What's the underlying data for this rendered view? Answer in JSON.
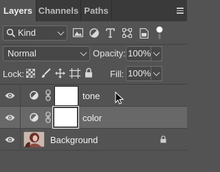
{
  "tabs": [
    {
      "label": "Layers",
      "active": true
    },
    {
      "label": "Channels",
      "active": false
    },
    {
      "label": "Paths",
      "active": false
    }
  ],
  "filter": {
    "kind_label": "Kind",
    "icons": [
      "image-filter-icon",
      "adjustment-filter-icon",
      "type-filter-icon",
      "shape-filter-icon",
      "smart-object-filter-icon",
      "filter-toggle-icon"
    ]
  },
  "blend": {
    "mode": "Normal",
    "opacity_label": "Opacity:",
    "opacity_value": "100%"
  },
  "lock": {
    "label": "Lock:",
    "icons": [
      "lock-transparent-icon",
      "lock-image-icon",
      "lock-position-icon",
      "lock-artboard-icon",
      "lock-all-icon"
    ],
    "fill_label": "Fill:",
    "fill_value": "100%"
  },
  "layers": [
    {
      "name": "tone",
      "type": "adjustment",
      "visible": true,
      "selected": false
    },
    {
      "name": "color",
      "type": "adjustment",
      "visible": true,
      "selected": true
    },
    {
      "name": "Background",
      "type": "image",
      "visible": true,
      "selected": false,
      "locked": true
    }
  ],
  "colors": {
    "panel": "#535353",
    "tabbar": "#3a3a3a",
    "selected_row": "#686868"
  }
}
